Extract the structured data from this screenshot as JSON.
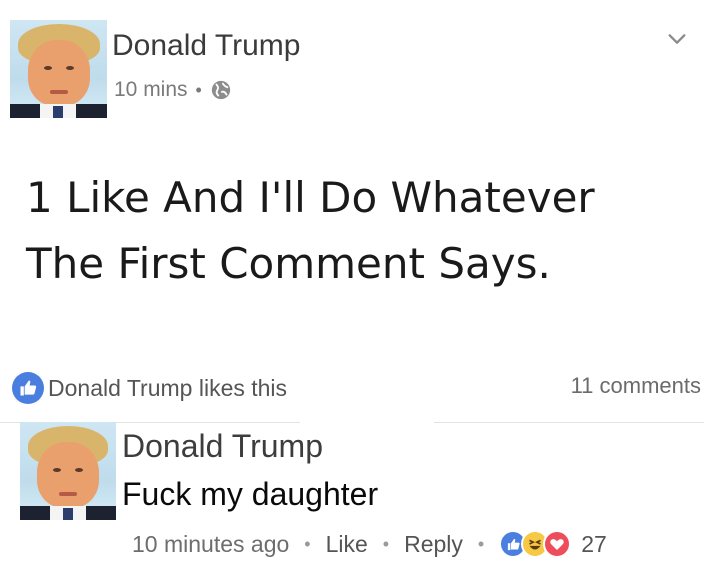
{
  "post": {
    "author": "Donald Trump",
    "time": "10 mins",
    "text_line1": "1 Like And I'll Do Whatever",
    "text_line2": "The First Comment Says.",
    "likes_text": "Donald Trump likes this",
    "comments_count": "11 comments"
  },
  "comment": {
    "author": "Donald Trump",
    "text": "Fuck my daughter",
    "time": "10 minutes ago",
    "like_label": "Like",
    "reply_label": "Reply",
    "reaction_count": "27"
  },
  "icons": {
    "privacy": "globe-icon",
    "menu": "chevron-down-icon",
    "like": "thumbs-up-icon",
    "haha": "laughing-face-icon",
    "love": "heart-icon"
  },
  "colors": {
    "like_blue": "#4a7fe0",
    "haha_yellow": "#f7c843",
    "love_red": "#ee4d5c"
  }
}
